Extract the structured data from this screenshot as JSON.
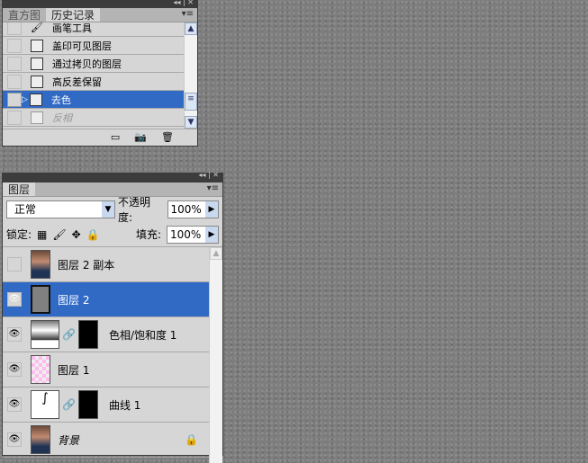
{
  "history_panel": {
    "tabs": [
      "直方图",
      "历史记录"
    ],
    "active_tab": 1,
    "items": [
      {
        "label": "画笔工具",
        "icon": "brush-icon"
      },
      {
        "label": "盖印可见图层",
        "icon": "history-state-icon"
      },
      {
        "label": "通过拷贝的图层",
        "icon": "history-state-icon"
      },
      {
        "label": "高反差保留",
        "icon": "history-state-icon"
      },
      {
        "label": "去色",
        "icon": "history-state-icon",
        "selected": true
      },
      {
        "label": "反相",
        "icon": "history-state-icon",
        "dimmed": true
      }
    ],
    "buttons": [
      "new-document-from-state",
      "new-snapshot",
      "delete"
    ]
  },
  "layers_panel": {
    "tab": "图层",
    "blend_mode": "正常",
    "opacity_label": "不透明度:",
    "opacity": "100%",
    "lock_label": "锁定:",
    "fill_label": "填充:",
    "fill": "100%",
    "layers": [
      {
        "name": "图层 2 副本",
        "visible": false,
        "thumb": "photo"
      },
      {
        "name": "图层 2",
        "visible": true,
        "selected": true,
        "thumb": "gray"
      },
      {
        "name": "色相/饱和度 1",
        "visible": true,
        "thumb": "adjust",
        "mask": true
      },
      {
        "name": "图层 1",
        "visible": true,
        "thumb": "transparent"
      },
      {
        "name": "曲线 1",
        "visible": true,
        "thumb": "curves",
        "mask": true
      },
      {
        "name": "背景",
        "visible": true,
        "thumb": "photo",
        "locked": true,
        "italic": true
      }
    ]
  }
}
